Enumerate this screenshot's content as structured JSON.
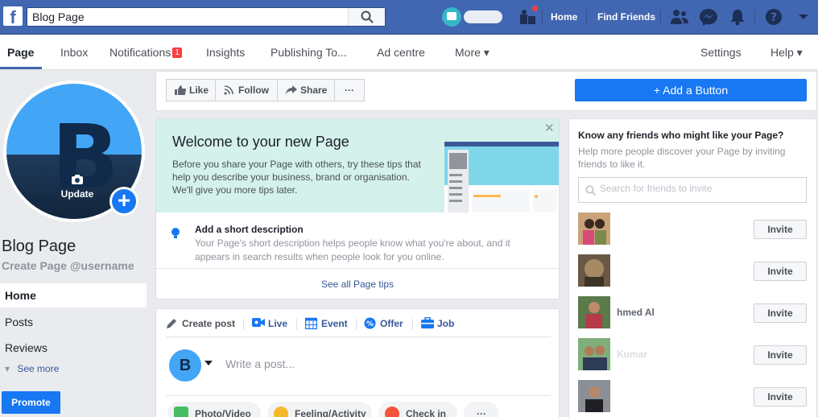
{
  "topbar": {
    "logo": "f",
    "search_value": "Blog Page",
    "links": [
      "Home",
      "Find Friends"
    ]
  },
  "tabs": [
    "Page",
    "Inbox",
    "Notifications",
    "Insights",
    "Publishing To...",
    "Ad centre",
    "More ▾",
    "Settings",
    "Help ▾"
  ],
  "notifications_badge": "1",
  "profile": {
    "initial": "B",
    "update_label": "Update",
    "page_name": "Blog Page",
    "username": "Create Page @username"
  },
  "nav": [
    "Home",
    "Posts",
    "Reviews"
  ],
  "see_more": "See more",
  "promote": "Promote",
  "actions": {
    "like": "Like",
    "follow": "Follow",
    "share": "Share",
    "more": "···",
    "add_button": "+ Add a Button"
  },
  "welcome": {
    "title": "Welcome to your new Page",
    "text": "Before you share your Page with others, try these tips that help you describe your business, brand or organisation. We'll give you more tips later.",
    "tip_title": "Add a short description",
    "tip_text": "Your Page's short description helps people know what you're about, and it appears in search results when people look for you online.",
    "see_all": "See all Page tips"
  },
  "post": {
    "tabs": [
      "Create post",
      "Live",
      "Event",
      "Offer",
      "Job"
    ],
    "avatar_initial": "B",
    "placeholder": "Write a post...",
    "pills": [
      "Photo/Video",
      "Feeling/Activity",
      "Check in",
      "···"
    ]
  },
  "friends": {
    "title": "Know any friends who might like your Page?",
    "subtitle": "Help more people discover your Page by inviting friends to like it.",
    "search_placeholder": "Search for friends to invite",
    "invite_label": "Invite",
    "names": [
      "",
      "",
      "hmed Al",
      "Kumar",
      ""
    ]
  },
  "colors": {
    "brand": "#4267b2",
    "accent": "#1877f2",
    "badge": "#fa3e3e"
  }
}
